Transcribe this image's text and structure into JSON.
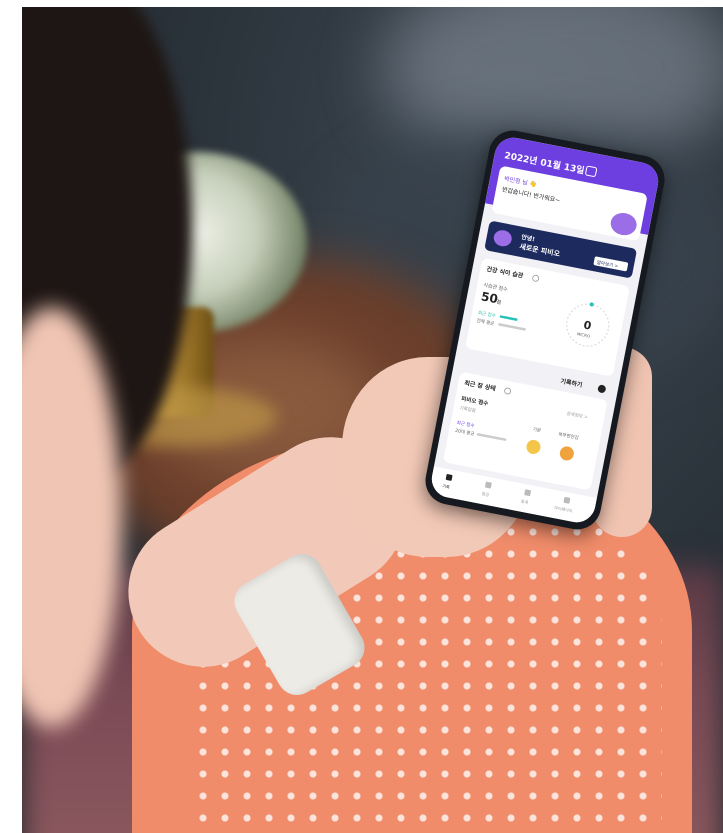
{
  "screen": {
    "date_title": "2022년 01월 13일",
    "greeting_name": "박민정 님 👋",
    "greeting_message": "반갑습니다! 반가워요~",
    "banner_line1": "안녕!",
    "banner_line2": "새로운 피비오",
    "banner_button": "알아보기 >",
    "card1_title": "건강 식이 습관",
    "card1_score_label": "식습관 점수",
    "card1_score_value": "50",
    "card1_score_unit": "점",
    "card1_row1": "최근 점수",
    "card1_row2": "전체 평균",
    "gauge_value": "0",
    "gauge_label": "MICRO",
    "record_button": "기록하기",
    "card2_title": "최근 장 상태",
    "card2_link": "상세정보 >",
    "card2_item_title": "피비오 점수",
    "card2_item_sub": "기록없음",
    "card2_row1": "최근 점수",
    "card2_row2": "20대 평균",
    "mood1_label": "기분",
    "mood2_label": "복부편안감",
    "nav_items": [
      "기록",
      "점검",
      "통계",
      "마이페이지"
    ]
  },
  "colors": {
    "brand_purple": "#6e3fe0",
    "teal": "#27c2b8",
    "navy_banner": "#1d2a5e",
    "mood_yellow": "#f3c64a",
    "mood_orange": "#f0a23c"
  }
}
